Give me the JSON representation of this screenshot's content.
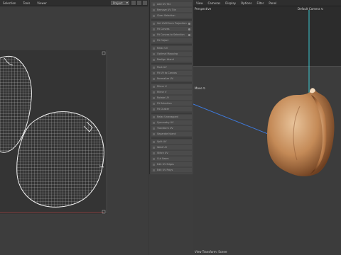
{
  "uv_editor": {
    "menus": [
      "Selection",
      "Tools",
      "Viewer"
    ],
    "mode_select": "Project",
    "tool_count": 3
  },
  "middle_panel": {
    "groups": [
      {
        "items": [
          "Add UV Tile",
          "Remove UV Tile",
          "Clear Selection"
        ]
      },
      {
        "items": [
          "Set UVW from Projection",
          "Fit Canvas",
          "Fit Canvas to Selection",
          "Fit Object"
        ]
      },
      {
        "items": [
          "Relax UV",
          "Optimal Mapping",
          "Realign Island"
        ]
      },
      {
        "items": [
          "Pack UV",
          "Fit UV to Canvas",
          "Normalize UV"
        ]
      },
      {
        "items": [
          "Mirror U",
          "Mirror V",
          "Rotate UV",
          "Fit Selection",
          "Fit Cluster"
        ]
      },
      {
        "items": [
          "Relax Unwrapped",
          "Symmetry UV",
          "Transform UV",
          "Separate Island"
        ]
      },
      {
        "items": [
          "Split UV",
          "Weld UV",
          "Stitch UV",
          "Cut Seam",
          "Edit UV Edges",
          "Edit UV Polys",
          "Edit UV Points",
          "Unwrap"
        ]
      }
    ]
  },
  "viewport": {
    "menus": [
      "View",
      "Cameras",
      "Display",
      "Options",
      "Filter",
      "Panel"
    ],
    "view_name": "Perspective",
    "camera_label": "Default Camera",
    "camera_mark": "↻",
    "axis_label": "Move",
    "axis_mark": "↻",
    "status": "View Transform: Scene"
  },
  "colors": {
    "accent_axis": "#3cc8d0",
    "axis_blue": "#3e7be0",
    "border_red": "#a04040"
  }
}
